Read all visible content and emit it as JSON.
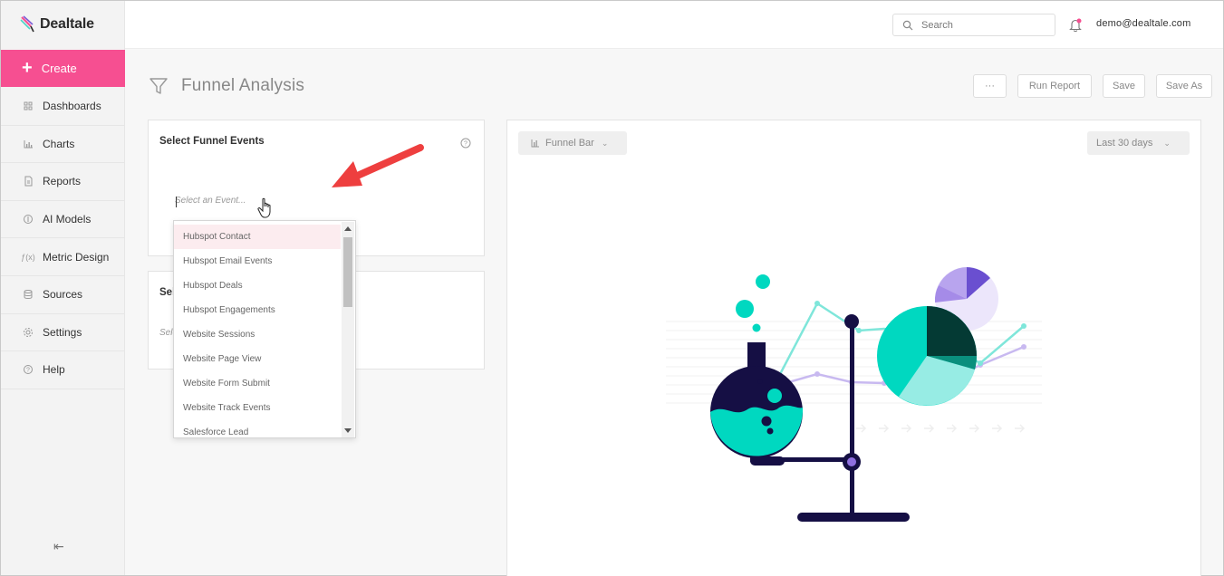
{
  "brand": {
    "name": "Dealtale"
  },
  "sidebar": {
    "create_label": "Create",
    "items": [
      {
        "label": "Dashboards",
        "icon": "grid-icon"
      },
      {
        "label": "Charts",
        "icon": "bar-chart-icon"
      },
      {
        "label": "Reports",
        "icon": "document-icon"
      },
      {
        "label": "AI Models",
        "icon": "ai-icon"
      },
      {
        "label": "Metric Design",
        "icon": "function-icon"
      },
      {
        "label": "Sources",
        "icon": "database-icon"
      },
      {
        "label": "Settings",
        "icon": "gear-icon"
      },
      {
        "label": "Help",
        "icon": "question-icon"
      }
    ]
  },
  "header": {
    "search_placeholder": "Search",
    "user_email": "demo@dealtale.com"
  },
  "page": {
    "title": "Funnel Analysis",
    "more_label": "···",
    "run_report_label": "Run Report",
    "save_label": "Save",
    "save_as_label": "Save As"
  },
  "funnel_panel": {
    "title": "Select Funnel Events",
    "event_placeholder": "Select an Event...",
    "dropdown_options": [
      "Hubspot Contact",
      "Hubspot Email Events",
      "Hubspot Deals",
      "Hubspot Engagements",
      "Website Sessions",
      "Website Page View",
      "Website Form Submit",
      "Website Track Events",
      "Salesforce Lead"
    ]
  },
  "second_panel": {
    "title_partial": "Sel",
    "placeholder_partial": "Sele"
  },
  "chart_panel": {
    "chart_type": "Funnel Bar",
    "date_range": "Last 30 days"
  },
  "colors": {
    "brand_pink": "#f64f91",
    "teal": "#00d8c0",
    "navy": "#150f44",
    "purple": "#8e6fe0"
  }
}
